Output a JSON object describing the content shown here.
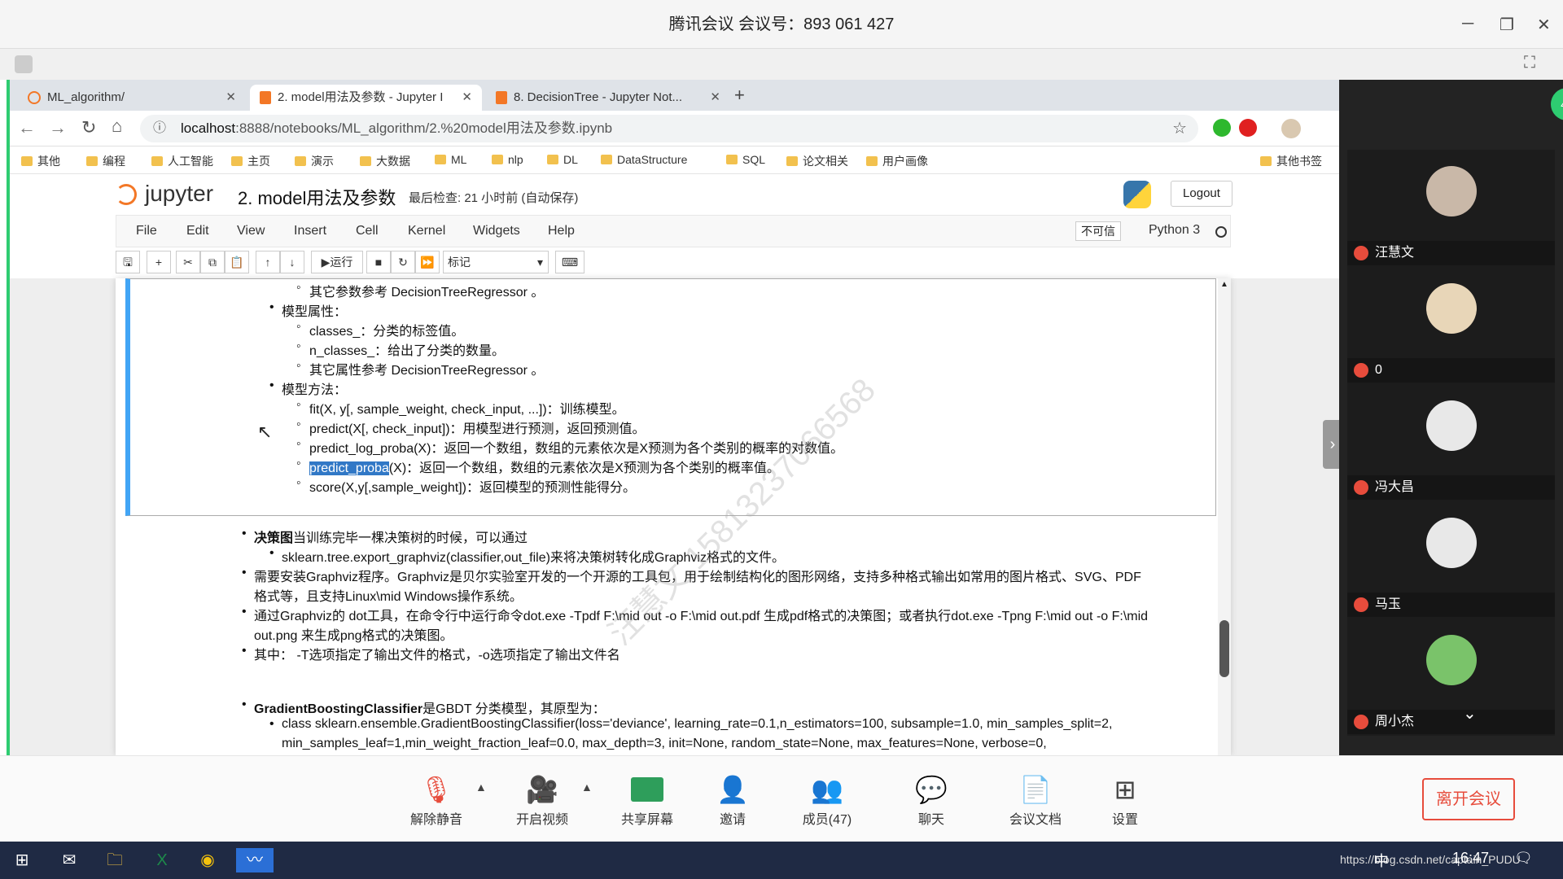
{
  "meeting": {
    "title": "腾讯会议 会议号：893 061 427"
  },
  "browser": {
    "tabs": [
      {
        "label": "ML_algorithm/"
      },
      {
        "label": "2. model用法及参数 - Jupyter I"
      },
      {
        "label": "8. DecisionTree - Jupyter Not..."
      }
    ],
    "url_host": "localhost",
    "url_path": ":8888/notebooks/ML_algorithm/2.%20model用法及参数.ipynb",
    "bookmarks": [
      "其他",
      "编程",
      "人工智能",
      "主页",
      "演示",
      "大数据",
      "ML",
      "nlp",
      "DL",
      "DataStructure",
      "SQL",
      "论文相关",
      "用户画像"
    ],
    "other_bookmarks": "其他书签"
  },
  "jupyter": {
    "logo": "jupyter",
    "notebook_name": "2. model用法及参数",
    "checkpoint": "最后检查: 21 小时前  (自动保存)",
    "logout": "Logout",
    "menus": [
      "File",
      "Edit",
      "View",
      "Insert",
      "Cell",
      "Kernel",
      "Widgets",
      "Help"
    ],
    "trust": "不可信",
    "kernel": "Python 3",
    "run_label": "运行",
    "cell_type": "标记"
  },
  "cell1": {
    "l1": "其它参数参考 DecisionTreeRegressor 。",
    "attr_title": "模型属性：",
    "attr1": "classes_：分类的标签值。",
    "attr2": "n_classes_：给出了分类的数量。",
    "attr3": "其它属性参考 DecisionTreeRegressor 。",
    "method_title": "模型方法：",
    "m1": "fit(X, y[, sample_weight, check_input, ...])：训练模型。",
    "m2": "predict(X[, check_input])：用模型进行预测，返回预测值。",
    "m3": "predict_log_proba(X)：返回一个数组，数组的元素依次是X预测为各个类别的概率的对数值。",
    "m4_sel": "predict_proba",
    "m4_rest": "(X)：返回一个数组，数组的元素依次是X预测为各个类别的概率值。",
    "m5": "score(X,y[,sample_weight])：返回模型的预测性能得分。"
  },
  "cell2": {
    "p1_bold": "决策图",
    "p1_rest": "当训练完毕一棵决策树的时候，可以通过",
    "p1_sub": "sklearn.tree.export_graphviz(classifier,out_file)来将决策树转化成Graphviz格式的文件。",
    "p2a": "需要安装Graphviz程序。Graphviz是贝尔实验室开发的一个开源的工具包，用于绘制结构化的图形网络，支持多种格式输出如常用的图片格式、SVG、PDF",
    "p2b": "格式等，且支持Linux\\mid Windows操作系统。",
    "p3a": "通过Graphviz的 dot工具，在命令行中运行命令dot.exe -Tpdf F:\\mid out -o F:\\mid out.pdf 生成pdf格式的决策图；或者执行dot.exe -Tpng F:\\mid out -o F:\\mid",
    "p3b": "out.png 来生成png格式的决策图。",
    "p4": "其中： -T选项指定了输出文件的格式，-o选项指定了输出文件名",
    "g_bold": "GradientBoostingClassifier",
    "g_rest": "是GBDT 分类模型，其原型为：",
    "g_sub1": "class sklearn.ensemble.GradientBoostingClassifier(loss='deviance', learning_rate=0.1,n_estimators=100, subsample=1.0, min_samples_split=2,",
    "g_sub2": "min_samples_leaf=1,min_weight_fraction_leaf=0.0, max_depth=3, init=None, random_state=None, max_features=None, verbose=0,"
  },
  "participants": [
    {
      "name": "汪慧文"
    },
    {
      "name": "0"
    },
    {
      "name": "冯大昌"
    },
    {
      "name": "马玉"
    },
    {
      "name": "周小杰"
    }
  ],
  "participant_count": "47",
  "controls": {
    "mute": "解除静音",
    "video": "开启视频",
    "share": "共享屏幕",
    "invite": "邀请",
    "members": "成员(47)",
    "chat": "聊天",
    "docs": "会议文档",
    "settings": "设置",
    "leave": "离开会议"
  },
  "taskbar": {
    "clock": "16:47",
    "url_overlay": "https://blog.csdn.net/captain_PUDU",
    "ime": "中"
  },
  "watermark": "汪慧文 15813237066568",
  "colors": {
    "jupyter_orange": "#F37726",
    "selection": "#3178c6",
    "meeting_green": "#2ecc71",
    "leave_red": "#e74c3c"
  }
}
